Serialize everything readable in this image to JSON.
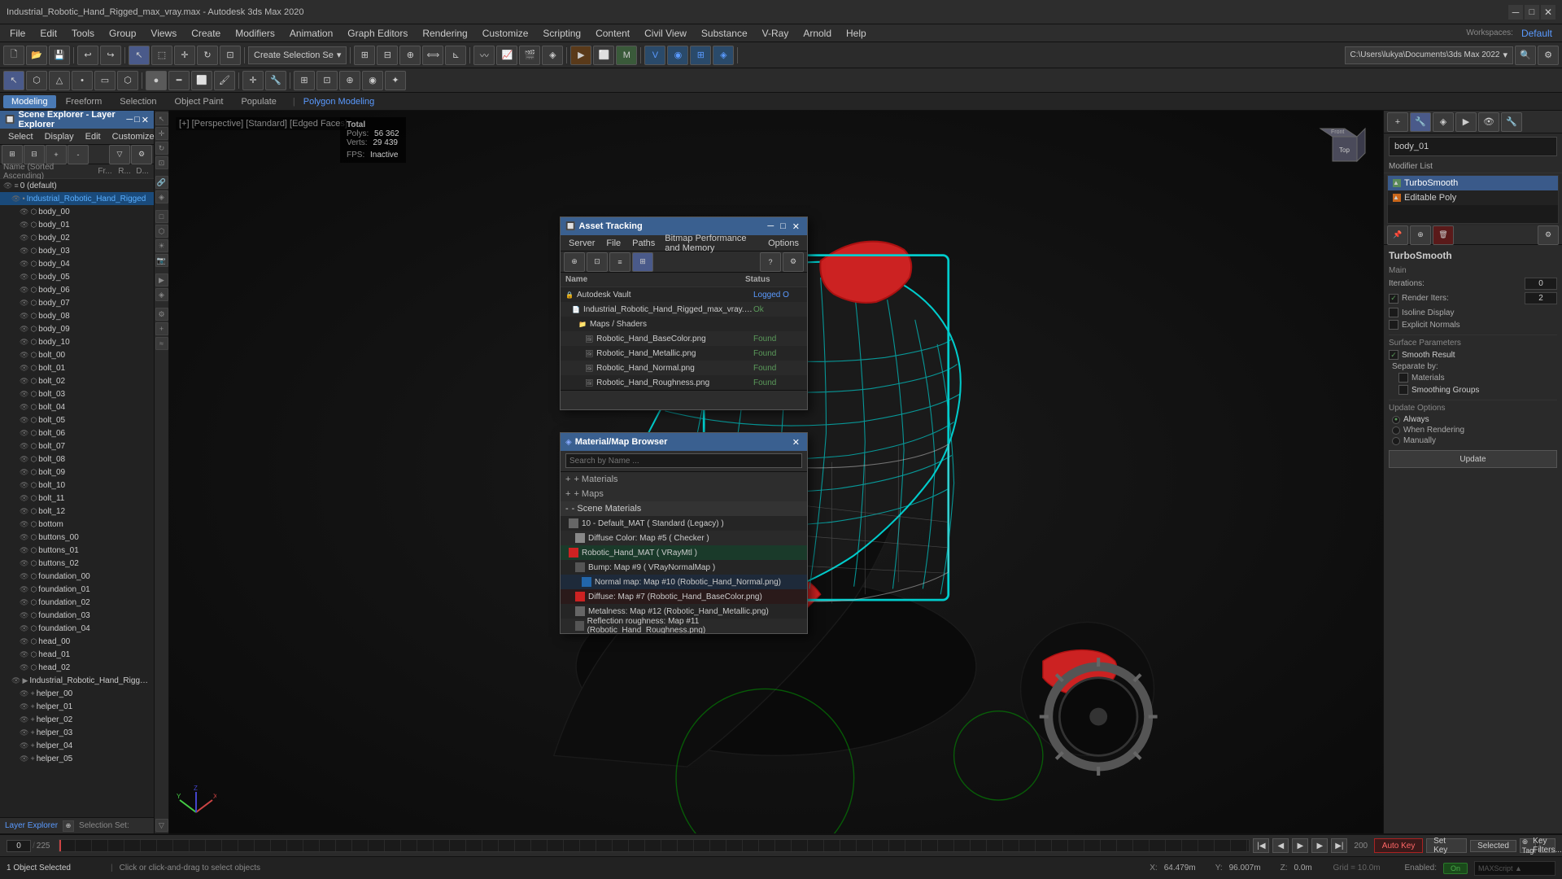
{
  "app": {
    "title": "Industrial_Robotic_Hand_Rigged_max_vray.max - Autodesk 3ds Max 2020",
    "workspace": "Default"
  },
  "menu": {
    "items": [
      "File",
      "Edit",
      "Tools",
      "Group",
      "Views",
      "Create",
      "Modifiers",
      "Animation",
      "Graph Editors",
      "Rendering",
      "Customize",
      "Scripting",
      "Content",
      "Civil View",
      "Substance",
      "V-Ray",
      "Arnold",
      "Help"
    ]
  },
  "toolbar": {
    "create_selection_label": "Create Selection Se",
    "path_label": "C:\\Users\\lukya\\Documents\\3ds Max 2022"
  },
  "mode_bar": {
    "modes": [
      "Modeling",
      "Freeform",
      "Selection",
      "Object Paint",
      "Populate"
    ],
    "active": "Modeling",
    "sub_mode": "Polygon Modeling"
  },
  "layer_explorer": {
    "title": "Scene Explorer - Layer Explorer",
    "window_title": "Layer Explorer",
    "menus": [
      "Select",
      "Display",
      "Edit",
      "Customize"
    ],
    "header": {
      "name_col": "Name (Sorted Ascending)",
      "fr_col": "Fr...",
      "r_col": "R...",
      "d_col": "D..."
    },
    "layers": [
      {
        "id": "default",
        "name": "0 (default)",
        "level": 0,
        "type": "layer"
      },
      {
        "id": "robot_hand",
        "name": "Industrial_Robotic_Hand_Rigged",
        "level": 1,
        "type": "object",
        "selected": true
      },
      {
        "id": "body_00",
        "name": "body_00",
        "level": 2,
        "type": "mesh"
      },
      {
        "id": "body_01",
        "name": "body_01",
        "level": 2,
        "type": "mesh"
      },
      {
        "id": "body_02",
        "name": "body_02",
        "level": 2,
        "type": "mesh"
      },
      {
        "id": "body_03",
        "name": "body_03",
        "level": 2,
        "type": "mesh"
      },
      {
        "id": "body_04",
        "name": "body_04",
        "level": 2,
        "type": "mesh"
      },
      {
        "id": "body_05",
        "name": "body_05",
        "level": 2,
        "type": "mesh"
      },
      {
        "id": "body_06",
        "name": "body_06",
        "level": 2,
        "type": "mesh"
      },
      {
        "id": "body_07",
        "name": "body_07",
        "level": 2,
        "type": "mesh"
      },
      {
        "id": "body_08",
        "name": "body_08",
        "level": 2,
        "type": "mesh"
      },
      {
        "id": "body_09",
        "name": "body_09",
        "level": 2,
        "type": "mesh"
      },
      {
        "id": "body_10",
        "name": "body_10",
        "level": 2,
        "type": "mesh"
      },
      {
        "id": "bolt_00",
        "name": "bolt_00",
        "level": 2,
        "type": "mesh"
      },
      {
        "id": "bolt_01",
        "name": "bolt_01",
        "level": 2,
        "type": "mesh"
      },
      {
        "id": "bolt_02",
        "name": "bolt_02",
        "level": 2,
        "type": "mesh"
      },
      {
        "id": "bolt_03",
        "name": "bolt_03",
        "level": 2,
        "type": "mesh"
      },
      {
        "id": "bolt_04",
        "name": "bolt_04",
        "level": 2,
        "type": "mesh"
      },
      {
        "id": "bolt_05",
        "name": "bolt_05",
        "level": 2,
        "type": "mesh"
      },
      {
        "id": "bolt_06",
        "name": "bolt_06",
        "level": 2,
        "type": "mesh"
      },
      {
        "id": "bolt_07",
        "name": "bolt_07",
        "level": 2,
        "type": "mesh"
      },
      {
        "id": "bolt_08",
        "name": "bolt_08",
        "level": 2,
        "type": "mesh"
      },
      {
        "id": "bolt_09",
        "name": "bolt_09",
        "level": 2,
        "type": "mesh"
      },
      {
        "id": "bolt_10",
        "name": "bolt_10",
        "level": 2,
        "type": "mesh"
      },
      {
        "id": "bolt_11",
        "name": "bolt_11",
        "level": 2,
        "type": "mesh"
      },
      {
        "id": "bolt_12",
        "name": "bolt_12",
        "level": 2,
        "type": "mesh"
      },
      {
        "id": "bottom",
        "name": "bottom",
        "level": 2,
        "type": "mesh"
      },
      {
        "id": "buttons_00",
        "name": "buttons_00",
        "level": 2,
        "type": "mesh"
      },
      {
        "id": "buttons_01",
        "name": "buttons_01",
        "level": 2,
        "type": "mesh"
      },
      {
        "id": "buttons_02",
        "name": "buttons_02",
        "level": 2,
        "type": "mesh"
      },
      {
        "id": "foundation_00",
        "name": "foundation_00",
        "level": 2,
        "type": "mesh"
      },
      {
        "id": "foundation_01",
        "name": "foundation_01",
        "level": 2,
        "type": "mesh"
      },
      {
        "id": "foundation_02",
        "name": "foundation_02",
        "level": 2,
        "type": "mesh"
      },
      {
        "id": "foundation_03",
        "name": "foundation_03",
        "level": 2,
        "type": "mesh"
      },
      {
        "id": "foundation_04",
        "name": "foundation_04",
        "level": 2,
        "type": "mesh"
      },
      {
        "id": "head_00",
        "name": "head_00",
        "level": 2,
        "type": "mesh"
      },
      {
        "id": "head_01",
        "name": "head_01",
        "level": 2,
        "type": "mesh"
      },
      {
        "id": "head_02",
        "name": "head_02",
        "level": 2,
        "type": "mesh"
      },
      {
        "id": "controllers",
        "name": "Industrial_Robotic_Hand_Rigged_Controllers",
        "level": 1,
        "type": "group"
      },
      {
        "id": "helper_00",
        "name": "helper_00",
        "level": 2,
        "type": "helper"
      },
      {
        "id": "helper_01",
        "name": "helper_01",
        "level": 2,
        "type": "helper"
      },
      {
        "id": "helper_02",
        "name": "helper_02",
        "level": 2,
        "type": "helper"
      },
      {
        "id": "helper_03",
        "name": "helper_03",
        "level": 2,
        "type": "helper"
      },
      {
        "id": "helper_04",
        "name": "helper_04",
        "level": 2,
        "type": "helper"
      },
      {
        "id": "helper_05",
        "name": "helper_05",
        "level": 2,
        "type": "helper"
      }
    ]
  },
  "info_panel": {
    "total_label": "Total",
    "polys_label": "Polys:",
    "polys_value": "56 362",
    "verts_label": "Verts:",
    "verts_value": "29 439",
    "fps_label": "FPS:",
    "fps_value": "Inactive"
  },
  "viewport": {
    "label": "[+] [Perspective] [Standard] [Edged Faces]"
  },
  "right_panel": {
    "object_name": "body_01",
    "modifier_list_label": "Modifier List",
    "modifiers": [
      {
        "name": "TurboSmooth",
        "active": true
      },
      {
        "name": "Editable Poly",
        "active": false
      }
    ],
    "turbosmooth": {
      "title": "TurboSmooth",
      "main_label": "Main",
      "iterations_label": "Iterations:",
      "iterations_value": "0",
      "render_iters_label": "Render Iters:",
      "render_iters_value": "2",
      "isoline_display": "Isoline Display",
      "explicit_normals": "Explicit Normals",
      "surface_params_label": "Surface Parameters",
      "smooth_result": "Smooth Result",
      "separate_by_label": "Separate by:",
      "materials": "Materials",
      "smoothing_groups": "Smoothing Groups",
      "update_options_label": "Update Options",
      "always": "Always",
      "when_rendering": "When Rendering",
      "manually": "Manually",
      "update_btn": "Update"
    }
  },
  "asset_tracking": {
    "title": "Asset Tracking",
    "menus": [
      "Server",
      "File",
      "Paths",
      "Bitmap Performance and Memory",
      "Options"
    ],
    "columns": [
      "Name",
      "Status"
    ],
    "items": [
      {
        "name": "Autodesk Vault",
        "status": "Logged O",
        "type": "vault",
        "level": 0
      },
      {
        "name": "Industrial_Robotic_Hand_Rigged_max_vray.max",
        "status": "Ok",
        "type": "file",
        "level": 1
      },
      {
        "name": "Maps / Shaders",
        "status": "",
        "type": "folder",
        "level": 2
      },
      {
        "name": "Robotic_Hand_BaseColor.png",
        "status": "Found",
        "type": "image",
        "level": 3
      },
      {
        "name": "Robotic_Hand_Metallic.png",
        "status": "Found",
        "type": "image",
        "level": 3
      },
      {
        "name": "Robotic_Hand_Normal.png",
        "status": "Found",
        "type": "image",
        "level": 3
      },
      {
        "name": "Robotic_Hand_Roughness.png",
        "status": "Found",
        "type": "image",
        "level": 3
      }
    ]
  },
  "material_browser": {
    "title": "Material/Map Browser",
    "search_placeholder": "Search by Name ...",
    "sections": [
      {
        "label": "+ Materials",
        "expanded": false
      },
      {
        "label": "+ Maps",
        "expanded": false
      },
      {
        "label": "- Scene Materials",
        "expanded": true
      }
    ],
    "scene_materials": [
      {
        "name": "10 - Default_MAT ( Standard (Legacy) )",
        "color": "gray",
        "active": false
      },
      {
        "name": "Diffuse Color: Map #5 ( Checker )",
        "color": "gray",
        "sub": true,
        "active": false
      },
      {
        "name": "Robotic_Hand_MAT ( VRayMtl )",
        "color": "red",
        "active": true
      },
      {
        "name": "Bump: Map #9 ( VRayNormalMap )",
        "color": "gray",
        "sub": true,
        "active": false
      },
      {
        "name": "Normal map: Map #10 (Robotic_Hand_Normal.png)",
        "color": "blue",
        "sub": true,
        "active": false
      },
      {
        "name": "Diffuse: Map #7 (Robotic_Hand_BaseColor.png)",
        "color": "red",
        "sub": true,
        "active": true
      },
      {
        "name": "Metalness: Map #12 (Robotic_Hand_Metallic.png)",
        "color": "gray",
        "sub": true,
        "active": false
      },
      {
        "name": "Reflection roughness: Map #11 (Robotic_Hand_Roughness.png)",
        "color": "gray",
        "sub": true,
        "active": false
      }
    ]
  },
  "status_bar": {
    "objects_selected": "1 Object Selected",
    "hint": "Click or click-and-drag to select objects",
    "bottom_panel_label": "Layer Explorer",
    "selection_set_label": "Selection Set:",
    "coords": {
      "x_label": "X:",
      "x_value": "64.479m",
      "y_label": "Y:",
      "y_value": "96.007m",
      "z_label": "Z:",
      "z_value": "0.0m",
      "grid_label": "Grid = 10.0m"
    },
    "enabled": "Enabled:",
    "enabled_value": "On",
    "auto_key": "Auto Key",
    "selected": "Selected",
    "set_key": "Set Key",
    "key_filters": "Key Filters..."
  },
  "timeline": {
    "current_frame": "0",
    "total_frames": "225",
    "frame_range_end": "200"
  }
}
